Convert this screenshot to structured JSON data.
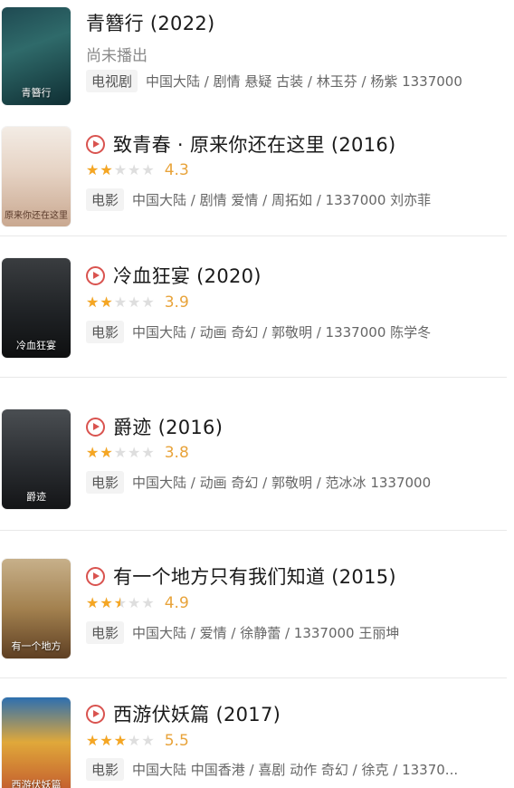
{
  "items": [
    {
      "title": "青簪行 (2022)",
      "status": "尚未播出",
      "badge": "电视剧",
      "meta": "中国大陆 / 剧情 悬疑 古装 / 林玉芬 / 杨紫 1337000",
      "poster_text": "青簪行",
      "playable": false
    },
    {
      "title": "致青春 · 原来你还在这里 (2016)",
      "stars": "★★★★★",
      "stars_filled": 2,
      "score": "4.3",
      "badge": "电影",
      "meta": "中国大陆 / 剧情 爱情 / 周拓如 / 1337000 刘亦菲",
      "poster_text": "原来你还在这里",
      "playable": true
    },
    {
      "title": "冷血狂宴 (2020)",
      "stars": "★★★★★",
      "stars_filled": 2,
      "score": "3.9",
      "badge": "电影",
      "meta": "中国大陆 / 动画 奇幻 / 郭敬明 / 1337000 陈学冬",
      "poster_text": "冷血狂宴",
      "playable": true
    },
    {
      "title": "爵迹 (2016)",
      "stars": "★★★★★",
      "stars_filled": 2,
      "score": "3.8",
      "badge": "电影",
      "meta": "中国大陆 / 动画 奇幻 / 郭敬明 / 范冰冰 1337000",
      "poster_text": "爵迹",
      "playable": true
    },
    {
      "title": "有一个地方只有我们知道 (2015)",
      "stars": "★★★★★",
      "stars_filled": 2.5,
      "score": "4.9",
      "badge": "电影",
      "meta": "中国大陆 / 爱情 / 徐静蕾 / 1337000 王丽坤",
      "poster_text": "有一个地方",
      "playable": true
    },
    {
      "title": "西游伏妖篇 (2017)",
      "stars": "★★★★★",
      "stars_filled": 3,
      "score": "5.5",
      "badge": "电影",
      "meta": "中国大陆 中国香港 / 喜剧 动作 奇幻 / 徐克 / 13370...",
      "poster_text": "西游伏妖篇",
      "playable": true
    }
  ],
  "colors": {
    "accent_red": "#d9534f",
    "star": "#f5a623",
    "score": "#e8a33a"
  }
}
